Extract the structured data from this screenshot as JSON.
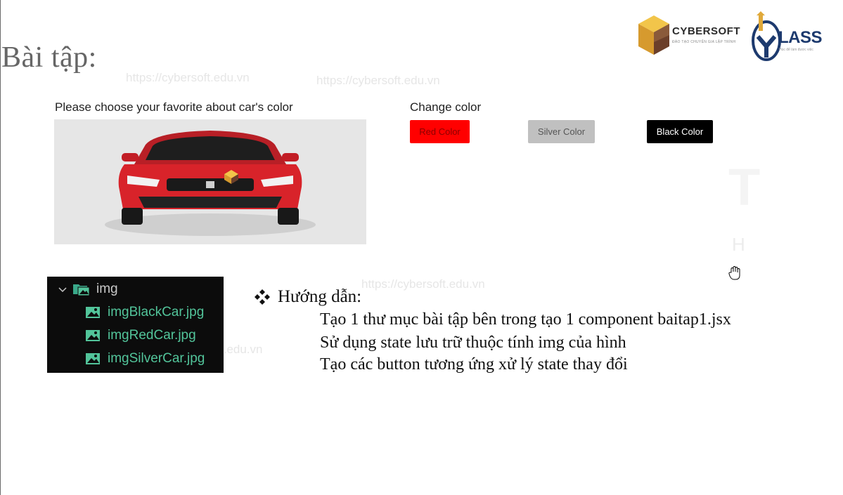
{
  "slide": {
    "title": "Bài tập:"
  },
  "watermarks": [
    "https://cybersoft.edu.vn",
    "https://cybersoft.edu.vn",
    "https://cybersoft.edu.vn",
    "t.edu.vn"
  ],
  "logos": {
    "cybersoft": {
      "name": "CYBERSOFT",
      "tagline": "ĐÀO TẠO CHUYÊN GIA LẬP TRÌNH",
      "colors": {
        "gold": "#e9b53f",
        "brown": "#6b3f2a"
      }
    },
    "myclass": {
      "name": "LASS",
      "tagline": "Học để làm được việc",
      "colors": {
        "navy": "#1d3a6e",
        "gold": "#e0a93a"
      }
    }
  },
  "demo": {
    "heading": "Please choose your favorite about car's color",
    "car_image": {
      "alt": "red car",
      "color": "#d8232a"
    },
    "change_label": "Change color",
    "buttons": [
      {
        "label": "Red Color",
        "color": "#ff0000"
      },
      {
        "label": "Silver Color",
        "color": "#c0c0c0"
      },
      {
        "label": "Black Color",
        "color": "#000000"
      }
    ],
    "ghost_letters": [
      "T",
      "H"
    ]
  },
  "file_tree": {
    "folder": "img",
    "files": [
      "imgBlackCar.jpg",
      "imgRedCar.jpg",
      "imgSilverCar.jpg"
    ]
  },
  "guide": {
    "heading": "Hướng dẫn:",
    "lines": [
      "Tạo 1 thư mục bài tập bên trong tạo 1 component baitap1.jsx",
      "Sử dụng state lưu trữ thuộc tính img của hình",
      "Tạo các button tương ứng xử lý state thay đổi"
    ]
  }
}
